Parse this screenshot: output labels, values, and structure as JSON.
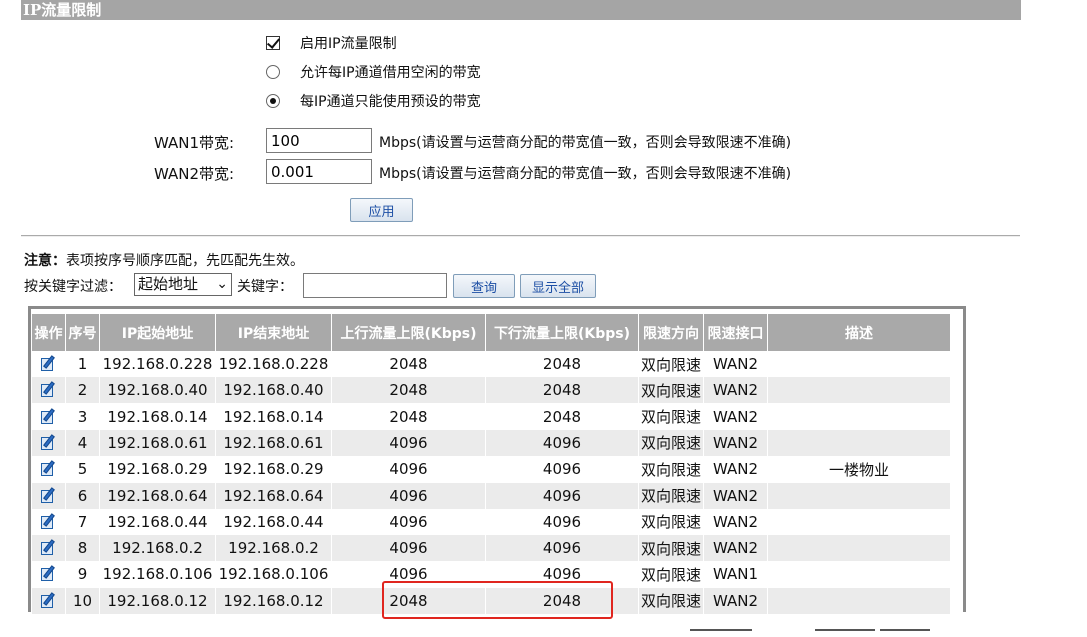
{
  "title": "IP流量限制",
  "options": {
    "enable_label": "启用IP流量限制",
    "borrow_label": "允许每IP通道借用空闲的带宽",
    "preset_label": "每IP通道只能使用预设的带宽"
  },
  "wan": {
    "wan1_label": "WAN1带宽:",
    "wan1_value": "100",
    "wan2_label": "WAN2带宽:",
    "wan2_value": "0.001",
    "unit_note": "Mbps(请设置与运营商分配的带宽值一致，否则会导致限速不准确)"
  },
  "apply_label": "应用",
  "note": {
    "bold": "注意：",
    "text": "表项按序号顺序匹配，先匹配先生效。"
  },
  "filter": {
    "label": "按关键字过滤：",
    "select_value": "起始地址",
    "keyword_label": "关键字：",
    "keyword_value": "",
    "search_label": "查询",
    "show_all_label": "显示全部"
  },
  "table": {
    "headers": [
      "操作",
      "序号",
      "IP起始地址",
      "IP结束地址",
      "上行流量上限(Kbps)",
      "下行流量上限(Kbps)",
      "限速方向",
      "限速接口",
      "描述"
    ],
    "rows": [
      {
        "no": "1",
        "start": "192.168.0.228",
        "end": "192.168.0.228",
        "up": "2048",
        "down": "2048",
        "dir": "双向限速",
        "iface": "WAN2",
        "desc": ""
      },
      {
        "no": "2",
        "start": "192.168.0.40",
        "end": "192.168.0.40",
        "up": "2048",
        "down": "2048",
        "dir": "双向限速",
        "iface": "WAN2",
        "desc": ""
      },
      {
        "no": "3",
        "start": "192.168.0.14",
        "end": "192.168.0.14",
        "up": "2048",
        "down": "2048",
        "dir": "双向限速",
        "iface": "WAN2",
        "desc": ""
      },
      {
        "no": "4",
        "start": "192.168.0.61",
        "end": "192.168.0.61",
        "up": "4096",
        "down": "4096",
        "dir": "双向限速",
        "iface": "WAN2",
        "desc": ""
      },
      {
        "no": "5",
        "start": "192.168.0.29",
        "end": "192.168.0.29",
        "up": "4096",
        "down": "4096",
        "dir": "双向限速",
        "iface": "WAN2",
        "desc": "一楼物业"
      },
      {
        "no": "6",
        "start": "192.168.0.64",
        "end": "192.168.0.64",
        "up": "4096",
        "down": "4096",
        "dir": "双向限速",
        "iface": "WAN2",
        "desc": ""
      },
      {
        "no": "7",
        "start": "192.168.0.44",
        "end": "192.168.0.44",
        "up": "4096",
        "down": "4096",
        "dir": "双向限速",
        "iface": "WAN2",
        "desc": ""
      },
      {
        "no": "8",
        "start": "192.168.0.2",
        "end": "192.168.0.2",
        "up": "4096",
        "down": "4096",
        "dir": "双向限速",
        "iface": "WAN2",
        "desc": ""
      },
      {
        "no": "9",
        "start": "192.168.0.106",
        "end": "192.168.0.106",
        "up": "4096",
        "down": "4096",
        "dir": "双向限速",
        "iface": "WAN1",
        "desc": ""
      },
      {
        "no": "10",
        "start": "192.168.0.12",
        "end": "192.168.0.12",
        "up": "2048",
        "down": "2048",
        "dir": "双向限速",
        "iface": "WAN2",
        "desc": ""
      }
    ]
  },
  "colors": {
    "header_bg": "#a9a9a9",
    "title_bg": "#a5a5a5",
    "alt_row": "#ebebeb",
    "highlight": "#e0261f",
    "button_text": "#1d4fa5"
  }
}
